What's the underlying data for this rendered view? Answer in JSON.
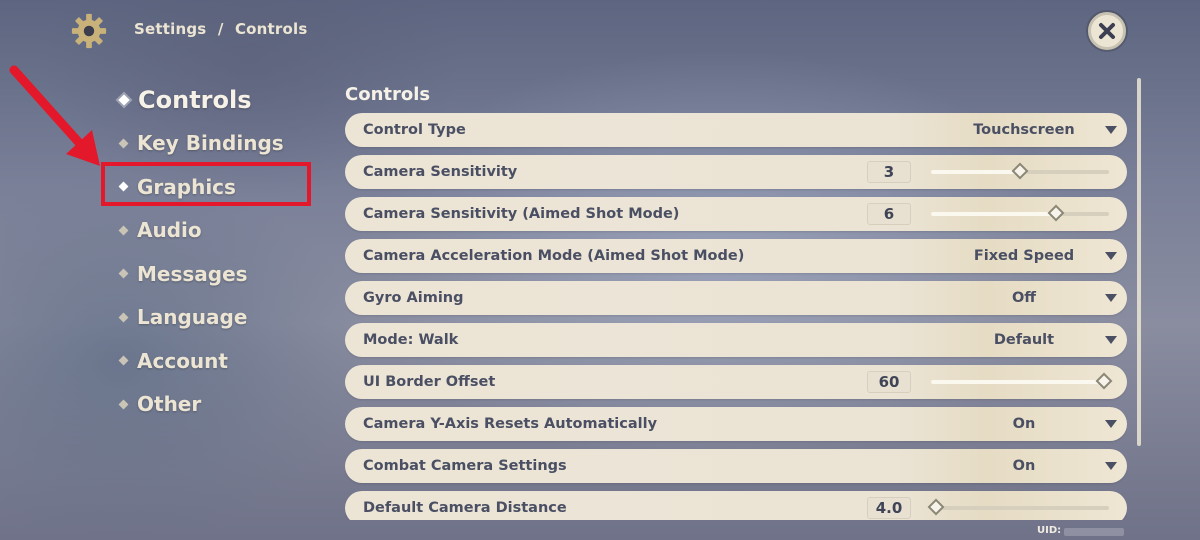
{
  "header": {
    "breadcrumb": [
      "Settings",
      "/",
      "Controls"
    ],
    "settings_icon": "gear-icon",
    "close_icon": "close-icon"
  },
  "sidebar": {
    "items": [
      {
        "label": "Controls",
        "active": true
      },
      {
        "label": "Key Bindings"
      },
      {
        "label": "Graphics",
        "highlighted": true
      },
      {
        "label": "Audio"
      },
      {
        "label": "Messages"
      },
      {
        "label": "Language"
      },
      {
        "label": "Account"
      },
      {
        "label": "Other"
      }
    ]
  },
  "annotation": {
    "color": "#e3192b",
    "target": "Graphics"
  },
  "main": {
    "title": "Controls",
    "settings": [
      {
        "label": "Control Type",
        "type": "dropdown",
        "value": "Touchscreen"
      },
      {
        "label": "Camera Sensitivity",
        "type": "slider",
        "value": "3",
        "level": 0.5
      },
      {
        "label": "Camera Sensitivity (Aimed Shot Mode)",
        "type": "slider",
        "value": "6",
        "level": 0.7
      },
      {
        "label": "Camera Acceleration Mode (Aimed Shot Mode)",
        "type": "dropdown",
        "value": "Fixed Speed"
      },
      {
        "label": "Gyro Aiming",
        "type": "dropdown",
        "value": "Off"
      },
      {
        "label": "Mode: Walk",
        "type": "dropdown",
        "value": "Default"
      },
      {
        "label": "UI Border Offset",
        "type": "slider",
        "value": "60",
        "level": 0.97
      },
      {
        "label": "Camera Y-Axis Resets Automatically",
        "type": "dropdown",
        "value": "On"
      },
      {
        "label": "Combat Camera Settings",
        "type": "dropdown",
        "value": "On"
      },
      {
        "label": "Default Camera Distance",
        "type": "slider",
        "value": "4.0",
        "level": 0.03
      }
    ]
  },
  "footer": {
    "uid_label": "UID:"
  }
}
